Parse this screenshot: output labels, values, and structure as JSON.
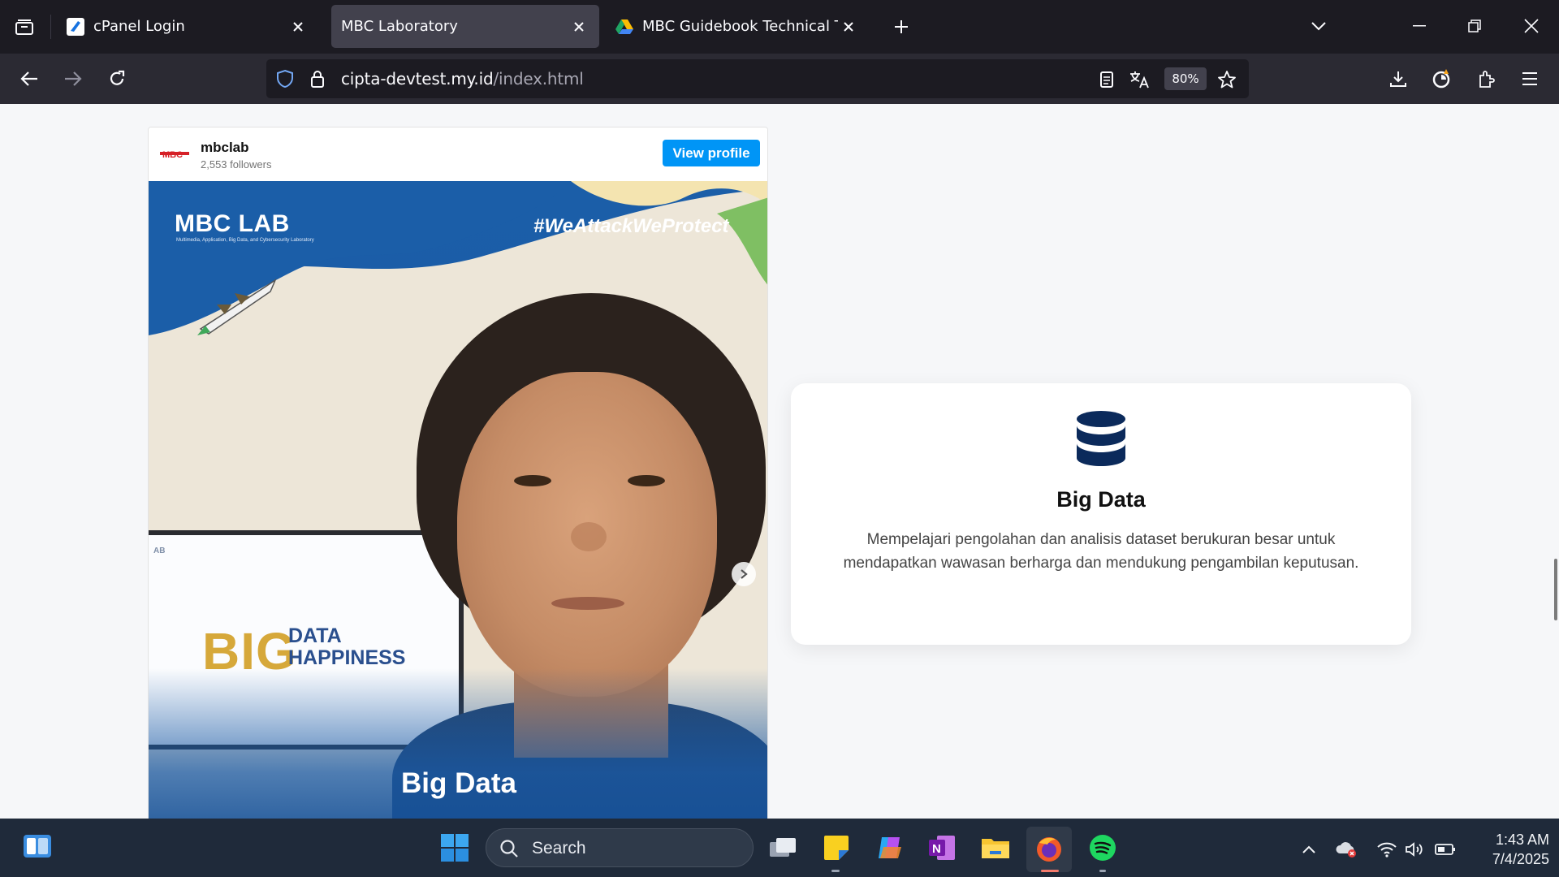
{
  "browser": {
    "tabs": [
      {
        "title": "cPanel Login",
        "active": false
      },
      {
        "title": "MBC Laboratory",
        "active": true
      },
      {
        "title": "MBC Guidebook Technical Test •",
        "active": false
      }
    ],
    "url_host": "cipta-devtest.my.id",
    "url_path": "/index.html",
    "zoom": "80%"
  },
  "instagram": {
    "username": "mbclab",
    "followers": "2,553 followers",
    "view_profile": "View profile",
    "post": {
      "brand": "MBC LAB",
      "brand_subtitle": "Multimedia, Application, Big Data, and Cybersecurity Laboratory",
      "hashtag": "#WeAttackWeProtect",
      "monitor_lab": "AB",
      "monitor_big": "BIG",
      "monitor_data": "DATA",
      "monitor_happiness": "HAPPINESS",
      "caption": "Big Data"
    }
  },
  "feature_card": {
    "icon": "database-icon",
    "title": "Big Data",
    "description": "Mempelajari pengolahan dan analisis dataset berukuran besar untuk mendapatkan wawasan berharga dan mendukung pengambilan keputusan."
  },
  "taskbar": {
    "search_placeholder": "Search",
    "time": "1:43 AM",
    "date": "7/4/2025"
  },
  "colors": {
    "accent_blue": "#0095f6",
    "card_icon": "#0b2a5b",
    "post_blue": "#1a5aa5"
  }
}
